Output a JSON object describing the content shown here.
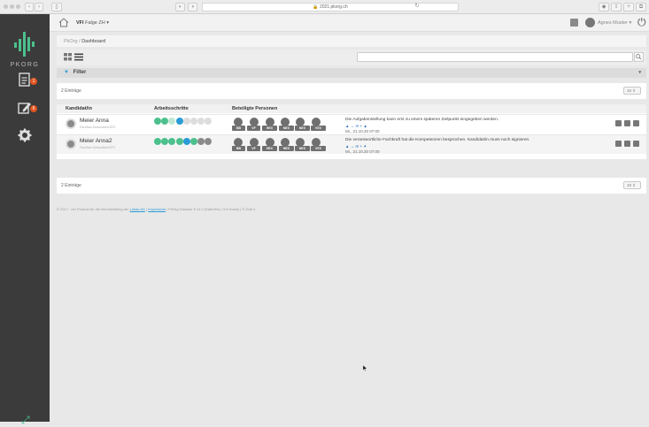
{
  "browser": {
    "url": "2021.pkorg.ch"
  },
  "sidebar": {
    "logo_text": "PKORG",
    "items": [
      {
        "icon": "document-icon",
        "badge": "1"
      },
      {
        "icon": "edit-icon",
        "badge": "6"
      },
      {
        "icon": "gear-icon",
        "badge": ""
      }
    ]
  },
  "topnav": {
    "context_prefix": "VFI",
    "context_value": "Falge ZH",
    "user_name": "Agnes Muster"
  },
  "breadcrumb": {
    "root": "PkOrg",
    "separator": "/",
    "current": "Dashboard"
  },
  "filter": {
    "label": "Filter"
  },
  "list": {
    "count_top": "2 Einträge",
    "count_bottom": "2 Einträge",
    "page_size": "10",
    "columns": [
      "Kandidat/in",
      "Arbeitsschritte",
      "Beteiligte Personen"
    ],
    "rows": [
      {
        "name": "Meier Anna",
        "subtitle": "Fachfrau Gesundheit EFZ",
        "person_tags": [
          "BB",
          "VF",
          "HEX",
          "NEX",
          "NEX",
          "VEX"
        ],
        "message": "Die Aufgabenstellung kann erst zu einem späteren Zeitpunkt eingegeben werden.",
        "message_meta": "▲ → ✉ + ▲",
        "date": "Mi., 21.10.20 07:00"
      },
      {
        "name": "Meier Anna2",
        "subtitle": "Fachfrau Gesundheit EFZ",
        "person_tags": [
          "BB",
          "VF",
          "HEX",
          "NEX",
          "NEX",
          "VEX"
        ],
        "message": "Die verantwortliche Fachkraft hat die Kompetenzen besprochen. Kandidat/in muss noch signieren.",
        "message_meta": "▲ → ✉ + ✦",
        "date": "Mi., 21.10.20 07:00"
      }
    ]
  },
  "footer": {
    "text": "© 2017 - ein Produkt für die Berufsbildung der",
    "link1": "Lukas AG",
    "sep": "|",
    "link2": "Impressum",
    "tail": "| PkOrg Dressler 5.11.0 (Datei:libs | 3.0.Hosst) | © OdA 4"
  },
  "colors": {
    "sidebar": "#3b3b3b",
    "accent_green": "#4cc08d",
    "accent_blue": "#2a9bd6",
    "badge_orange": "#e25522"
  }
}
